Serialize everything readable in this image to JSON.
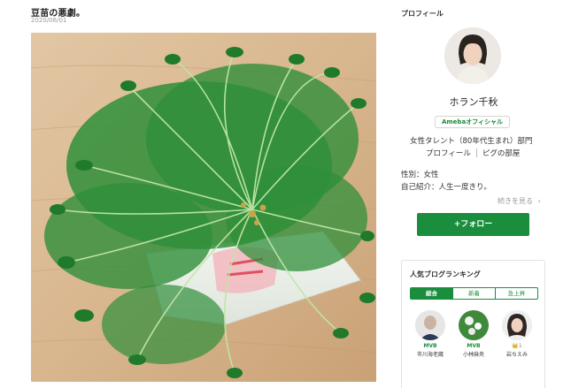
{
  "post": {
    "title": "豆苗の悪劇。",
    "date": "2020/06/01"
  },
  "sidebar": {
    "section_title": "プロフィール",
    "profile_name": "ホラン千秋",
    "official_badge": "Amebaオフィシャル",
    "genre": "女性タレント（80年代生まれ）部門",
    "links": [
      "プロフィール",
      "ピグの部屋"
    ],
    "gender": "性別：女性",
    "intro": "自己紹介：人生一度きり。",
    "more_label": "続きを見る",
    "follow_label": "+フォロー"
  },
  "ranking": {
    "title": "人気ブログランキング",
    "tabs": [
      "総合",
      "新着",
      "急上昇"
    ],
    "active_tab": "総合",
    "items": [
      {
        "badge": "MVB",
        "name": "市川海老蔵"
      },
      {
        "badge": "MVB",
        "name": "小林麻央"
      },
      {
        "badge": "👑1",
        "name": "岩ちえみ"
      }
    ]
  },
  "colors": {
    "accent": "#1a8e3d",
    "text": "#222222",
    "muted": "#999999"
  },
  "icons": {
    "more": "chevron-right-icon"
  }
}
